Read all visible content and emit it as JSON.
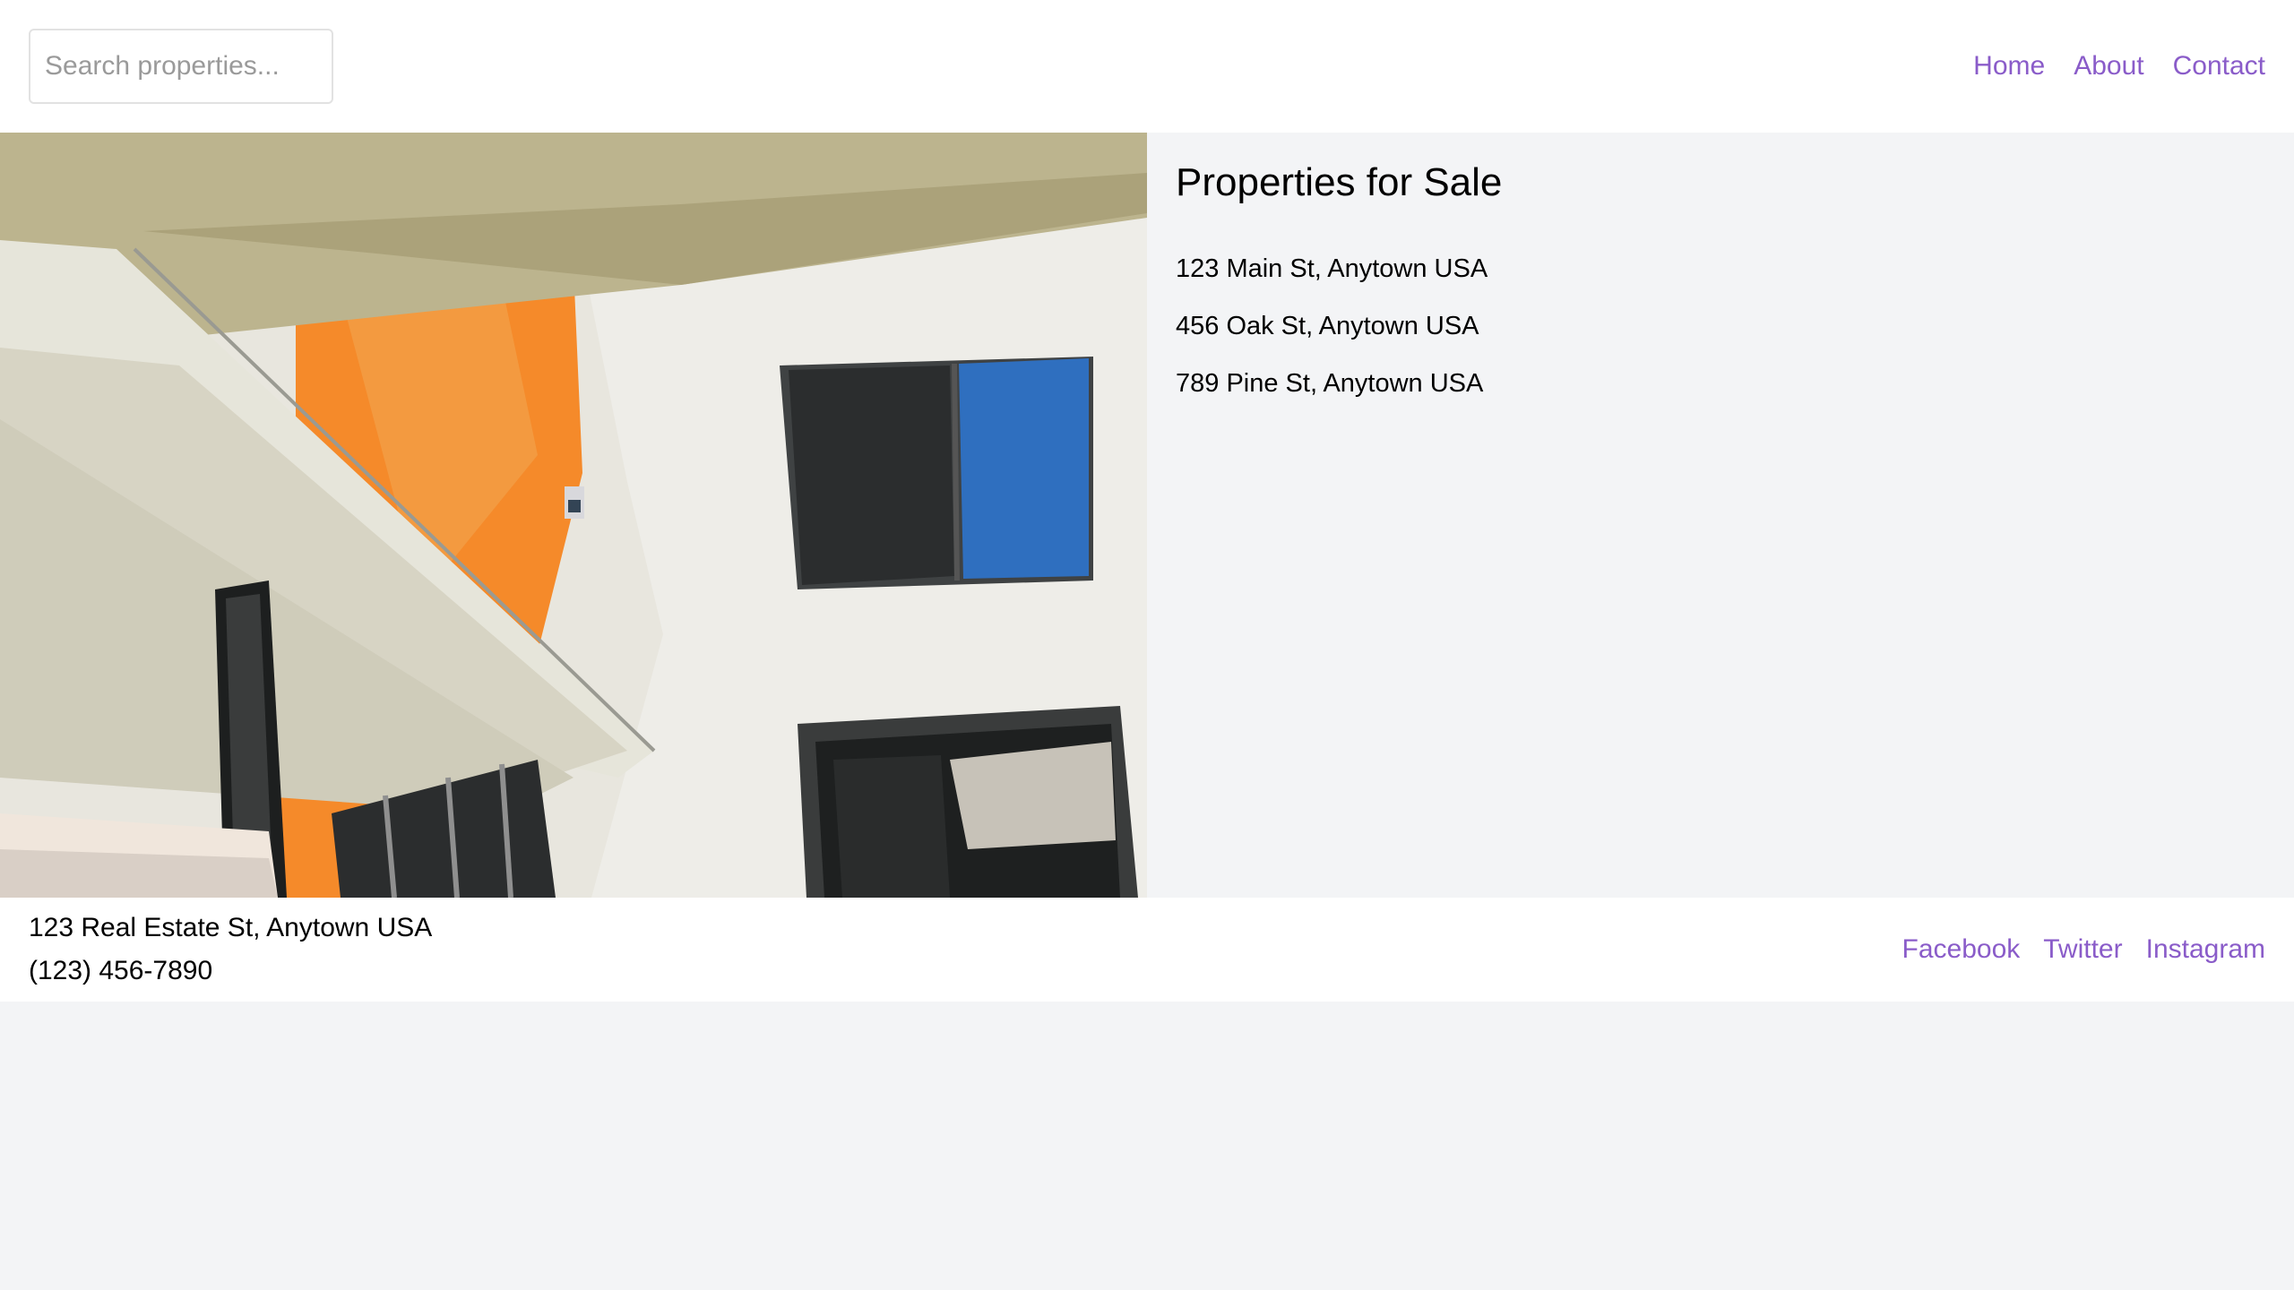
{
  "header": {
    "search": {
      "placeholder": "Search properties..."
    },
    "nav": [
      {
        "label": "Home"
      },
      {
        "label": "About"
      },
      {
        "label": "Contact"
      }
    ]
  },
  "listings": {
    "title": "Properties for Sale",
    "items": [
      {
        "address": "123 Main St, Anytown USA"
      },
      {
        "address": "456 Oak St, Anytown USA"
      },
      {
        "address": "789 Pine St, Anytown USA"
      }
    ]
  },
  "footer": {
    "address": "123 Real Estate St, Anytown USA",
    "phone": "(123) 456-7890",
    "social": [
      {
        "label": "Facebook"
      },
      {
        "label": "Twitter"
      },
      {
        "label": "Instagram"
      }
    ]
  },
  "colors": {
    "accent": "#8a5cc9",
    "page_background": "#f3f4f6",
    "surface": "#ffffff"
  }
}
